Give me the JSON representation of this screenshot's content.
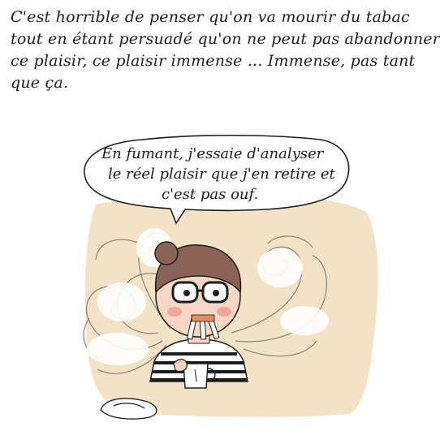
{
  "caption": {
    "lines": [
      "C'est horrible de penser qu'on va mourir du tabac",
      "tout en étant persuadé qu'on ne peut pas abandonner",
      "ce plaisir, ce plaisir immense ... Immense, pas tant",
      "que ça."
    ]
  },
  "speech": {
    "lines": [
      "En fumant, j'essaie d'analyser",
      "le réel plaisir que j'en retire et",
      "c'est pas ouf."
    ]
  },
  "colors": {
    "background_blob": "#f4e2c6",
    "hair": "#8a6356",
    "skin": "#f6d7c6",
    "cheek": "#ef9a8c",
    "smoke": "#ffffff",
    "ink": "#1c1c1c"
  },
  "icons": {
    "woman": "woman-smoking-illustration",
    "mug": "coffee-mug-icon",
    "ashtray": "ashtray-icon",
    "cigarettes": "cigarette-icon",
    "smoke": "smoke-swirl-icon"
  }
}
